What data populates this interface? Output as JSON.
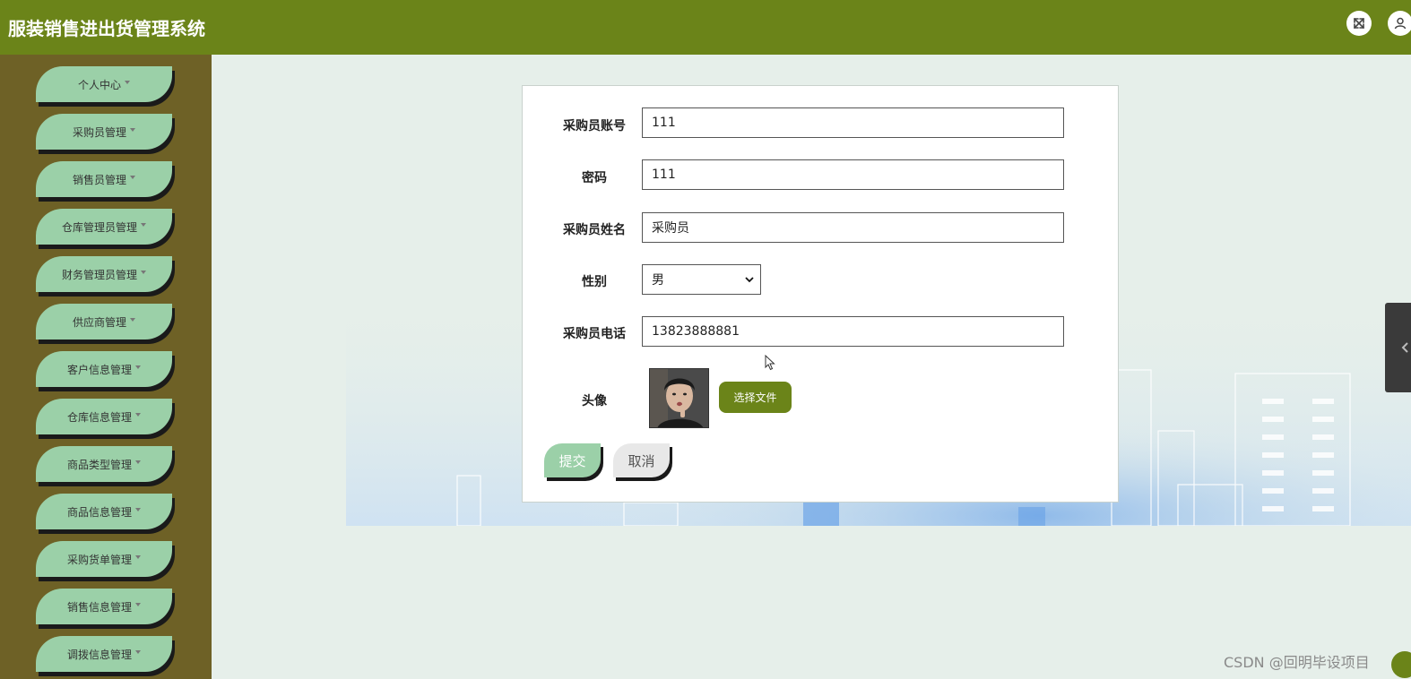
{
  "app": {
    "title": "服装销售进出货管理系统"
  },
  "header": {
    "fullscreen_icon": "expand-icon",
    "user_icon": "user-icon"
  },
  "sidebar": {
    "items": [
      {
        "label": "个人中心"
      },
      {
        "label": "采购员管理"
      },
      {
        "label": "销售员管理"
      },
      {
        "label": "仓库管理员管理"
      },
      {
        "label": "财务管理员管理"
      },
      {
        "label": "供应商管理"
      },
      {
        "label": "客户信息管理"
      },
      {
        "label": "仓库信息管理"
      },
      {
        "label": "商品类型管理"
      },
      {
        "label": "商品信息管理"
      },
      {
        "label": "采购货单管理"
      },
      {
        "label": "销售信息管理"
      },
      {
        "label": "调拨信息管理"
      }
    ]
  },
  "form": {
    "account_label": "采购员账号",
    "account_value": "111",
    "password_label": "密码",
    "password_value": "111",
    "name_label": "采购员姓名",
    "name_value": "采购员",
    "gender_label": "性别",
    "gender_value": "男",
    "phone_label": "采购员电话",
    "phone_value": "13823888881",
    "avatar_label": "头像",
    "file_button": "选择文件",
    "submit_button": "提交",
    "cancel_button": "取消"
  },
  "footer": {
    "watermark": "CSDN @回明毕设项目"
  },
  "colors": {
    "header_bg": "#6b8419",
    "sidebar_bg": "#6e6126",
    "menu_item_bg": "#9bd0a8",
    "main_bg": "#e6efea"
  }
}
